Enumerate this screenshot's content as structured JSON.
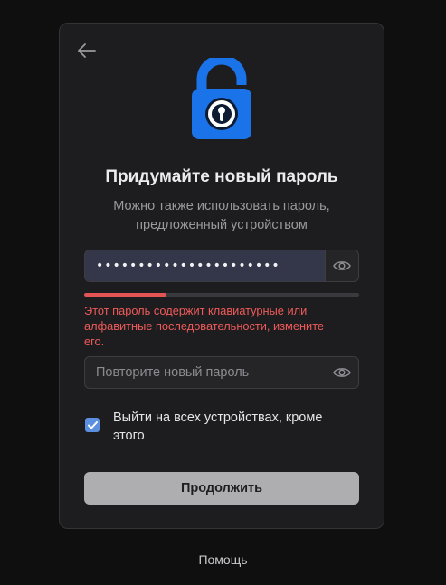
{
  "colors": {
    "background": "#0f0f10",
    "card": "#1d1d1f",
    "accent_blue": "#1a73e8",
    "error_red": "#f05a5a",
    "strength_bar": "#e45454",
    "checkbox": "#5b8fe0",
    "primary_button": "#aeaeb1"
  },
  "header": {
    "back_icon": "arrow-left-icon",
    "lock_icon": "unlocked-padlock-icon"
  },
  "title": "Придумайте новый пароль",
  "subtitle": "Можно также использовать пароль, предложенный устройством",
  "new_password": {
    "masked_value": "••••••••••••••••••••••",
    "toggle_icon": "eye-icon",
    "strength_fraction": 0.3,
    "error": "Этот пароль содержит клавиатурные или алфавитные последовательности, измените его."
  },
  "repeat_password": {
    "placeholder": "Повторите новый пароль",
    "toggle_icon": "eye-icon"
  },
  "logout_checkbox": {
    "checked": true,
    "label": "Выйти на всех устройствах, кроме этого"
  },
  "continue_button": "Продолжить",
  "help_link": "Помощь"
}
